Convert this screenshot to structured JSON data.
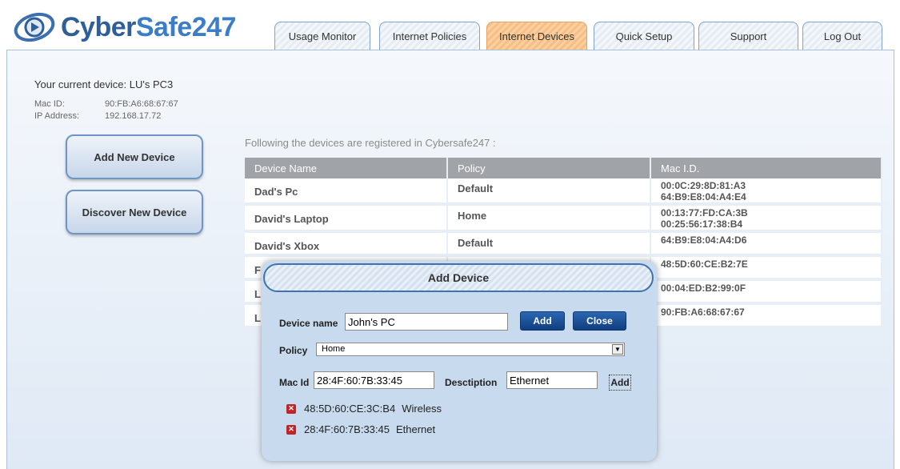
{
  "brand": {
    "name_part1": "Cyber",
    "name_part2": "Safe247"
  },
  "tabs": [
    {
      "label": "Usage Monitor"
    },
    {
      "label": "Internet Policies"
    },
    {
      "label": "Internet Devices",
      "active": true
    },
    {
      "label": "Quick Setup"
    },
    {
      "label": "Support"
    },
    {
      "label": "Log Out"
    }
  ],
  "current_device": {
    "text": "Your current device: LU's PC3",
    "mac_label": "Mac ID:",
    "mac_value": "90:FB:A6:68:67:67",
    "ip_label": "IP Address:",
    "ip_value": "192.168.17.72"
  },
  "sidebar": {
    "add_label": "Add New Device",
    "discover_label": "Discover New Device"
  },
  "devices": {
    "caption": "Following the devices are registered in Cybersafe247 :",
    "headers": [
      "Device Name",
      "Policy",
      "Mac I.D."
    ],
    "rows": [
      {
        "name": "Dad's Pc",
        "policy": "Default",
        "mac1": "00:0C:29:8D:81:A3",
        "mac2": "64:B9:E8:04:A4:E4"
      },
      {
        "name": "David's Laptop",
        "policy": "Home",
        "mac1": "00:13:77:FD:CA:3B",
        "mac2": "00:25:56:17:38:B4"
      },
      {
        "name": "David's Xbox",
        "policy": "Default",
        "mac1": "64:B9:E8:04:A4:D6",
        "mac2": ""
      },
      {
        "name": "F",
        "policy": "",
        "mac1": "48:5D:60:CE:B2:7E",
        "mac2": ""
      },
      {
        "name": "L",
        "policy": "",
        "mac1": "00:04:ED:B2:99:0F",
        "mac2": ""
      },
      {
        "name": "L",
        "policy": "",
        "mac1": "90:FB:A6:68:67:67",
        "mac2": ""
      }
    ]
  },
  "modal": {
    "title": "Add Device",
    "device_name_label": "Device name",
    "device_name_value": "John's PC",
    "add_button": "Add",
    "close_button": "Close",
    "policy_label": "Policy",
    "policy_value": "Home",
    "mac_label": "Mac Id",
    "mac_value": "28:4F:60:7B:33:45",
    "desc_label": "Desctiption",
    "desc_value": "Ethernet",
    "add_small": "Add",
    "entries": [
      {
        "mac": "48:5D:60:CE:3C:B4",
        "desc": "Wireless"
      },
      {
        "mac": "28:4F:60:7B:33:45",
        "desc": "Ethernet"
      }
    ]
  }
}
